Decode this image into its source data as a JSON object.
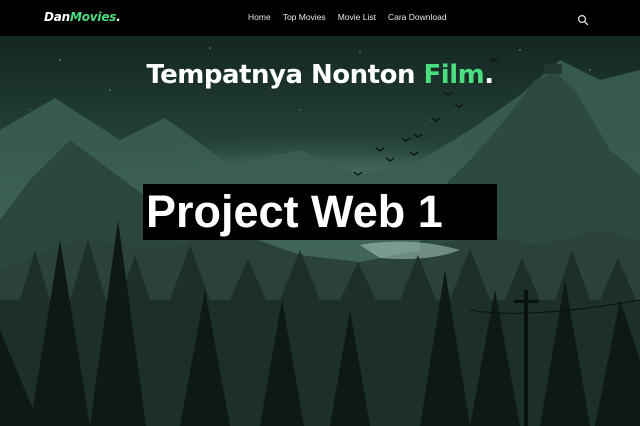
{
  "navbar": {
    "brand_prefix": "Dan",
    "brand_suffix": "Movies",
    "brand_dot": ".",
    "items": [
      {
        "label": "Home"
      },
      {
        "label": "Top Movies"
      },
      {
        "label": "Movie List"
      },
      {
        "label": "Cara Download"
      }
    ],
    "search_icon": "search-icon"
  },
  "hero": {
    "tagline_main": "Tempatnya Nonton ",
    "tagline_accent": "Film",
    "tagline_dot": ".",
    "label": "Project Web 1"
  },
  "colors": {
    "accent": "#4ade80",
    "navbar": "#000000",
    "sky_top": "#1f3b33",
    "sky_glow": "#8fb7a6"
  }
}
